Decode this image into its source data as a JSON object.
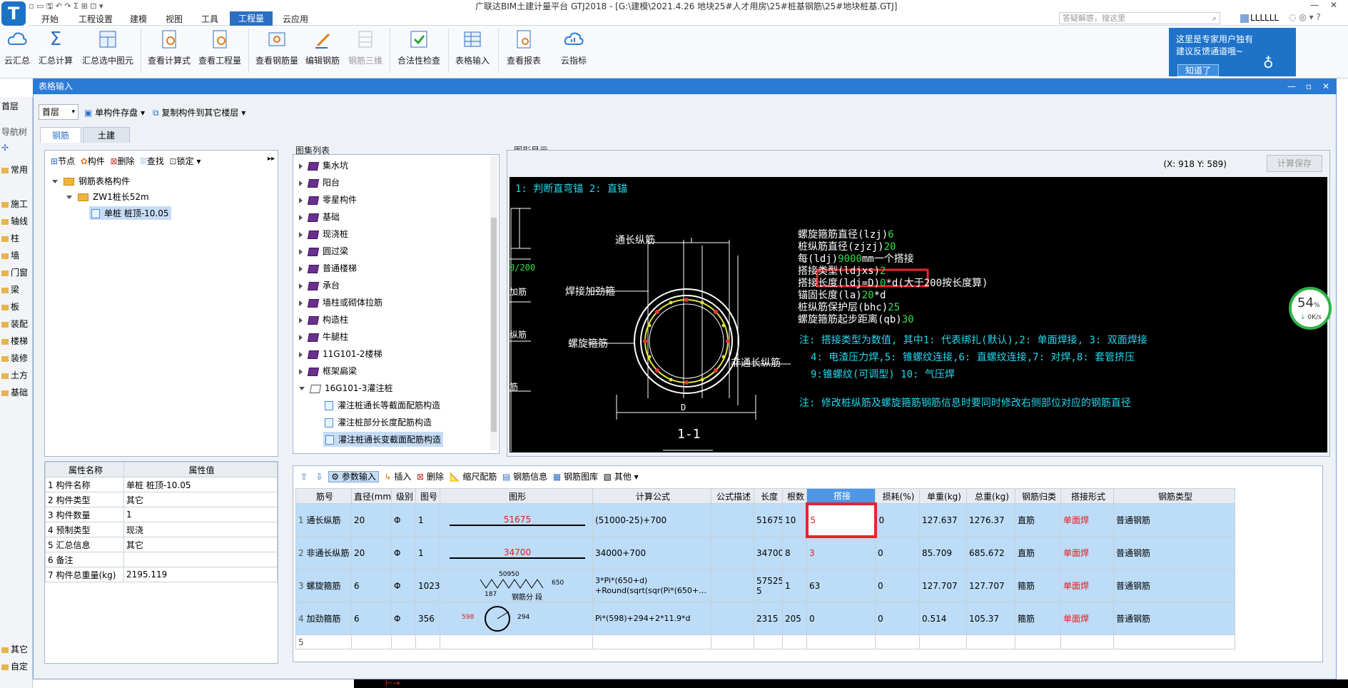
{
  "titlebar": {
    "title": "广联达BIM土建计量平台 GTJ2018 - [G:\\建模\\2021.4.26 地块25#人才用房\\25#桩基钢筋\\25#地块桩基.GTJ]",
    "search_placeholder": "答疑解惑，搜这里",
    "user": "LLLLLL"
  },
  "menu": [
    "开始",
    "工程设置",
    "建模",
    "视图",
    "工具",
    "工程量",
    "云应用"
  ],
  "ribbon": [
    "云汇总",
    "汇总计算",
    "汇总选中图元",
    "查看计算式",
    "查看工程量",
    "查看钢筋量",
    "编辑钢筋",
    "钢筋三维",
    "合法性检查",
    "表格输入",
    "查看报表",
    "云指标"
  ],
  "notice": {
    "line1": "这里是专家用户独有",
    "line2": "建议反馈通道哦~",
    "button": "知道了"
  },
  "left_strip": {
    "floor": "首层",
    "nav": "导航树",
    "items": [
      "常用",
      "施工",
      "轴线",
      "柱",
      "墙",
      "门窗",
      "梁",
      "板",
      "装配",
      "楼梯",
      "装修",
      "土方",
      "基础",
      "其它",
      "自定"
    ]
  },
  "dialog": {
    "title": "表格输入",
    "floor_select": "首层",
    "save_single": "单构件存盘",
    "copy_to_floor": "复制构件到其它楼层",
    "tabs": [
      "钢筋",
      "土建"
    ],
    "tree_toolbar": [
      "节点",
      "构件",
      "删除",
      "查找",
      "锁定"
    ],
    "tree": {
      "root": "钢筋表格构件",
      "child": "ZW1桩长52m",
      "leaf": "单桩 桩顶-10.05"
    },
    "props_headers": [
      "属性名称",
      "属性值"
    ],
    "props": [
      {
        "n": "1",
        "name": "构件名称",
        "value": "单桩 桩顶-10.05"
      },
      {
        "n": "2",
        "name": "构件类型",
        "value": "其它"
      },
      {
        "n": "3",
        "name": "构件数量",
        "value": "1"
      },
      {
        "n": "4",
        "name": "预制类型",
        "value": "现浇"
      },
      {
        "n": "5",
        "name": "汇总信息",
        "value": "其它"
      },
      {
        "n": "6",
        "name": "备注",
        "value": ""
      },
      {
        "n": "7",
        "name": "构件总重量(kg)",
        "value": "2195.119"
      }
    ],
    "atlas_title": "图集列表",
    "atlas": [
      "集水坑",
      "阳台",
      "零星构件",
      "基础",
      "现浇桩",
      "圆过梁",
      "普通楼梯",
      "承台",
      "墙柱或砌体拉筋",
      "构造柱",
      "牛腿柱",
      "11G101-2楼梯",
      "框架扁梁",
      "16G101-3灌注桩"
    ],
    "atlas_children": [
      "灌注桩通长等截面配筋构造",
      "灌注桩部分长度配筋构造",
      "灌注桩通长变截面配筋构造"
    ],
    "figure_title": "图形显示",
    "coords": "(X: 918 Y: 589)",
    "calc_save": "计算保存"
  },
  "canvas": {
    "top": "1: 判断直弯锚     2: 直锚",
    "label_long": "通长纵筋",
    "label_weld": "焊接加劲箍",
    "label_spiral": "螺旋箍筋",
    "label_nonlong": "非通长纵筋",
    "label_d": "D",
    "section": "1-1",
    "left_frag": [
      "0/200",
      "加筋",
      "纵筋",
      "筋"
    ],
    "params": [
      {
        "k": "螺旋箍筋直径(lzj)",
        "v": "6"
      },
      {
        "k": "桩纵筋直径(zjzj)",
        "v": "20"
      },
      {
        "k": "每(ldj)",
        "v": "9000",
        "s": "mm一个搭接"
      },
      {
        "k": "搭接类型(ldjxs)",
        "v": "2"
      },
      {
        "k": "搭接长度(ldj=D)",
        "v": "0",
        "s": "*d(大于200按长度算)"
      },
      {
        "k": "锚固长度(la)",
        "v": "20",
        "s": "*d"
      },
      {
        "k": "桩纵筋保护层(bhc)",
        "v": "25"
      },
      {
        "k": "螺旋箍筋起步距离(qb)",
        "v": "30"
      }
    ],
    "notes": [
      "注: 搭接类型为数值, 其中1: 代表绑扎(默认),2: 单面焊接, 3: 双面焊接",
      "4: 电渣压力焊,5: 锥螺纹连接,6: 直螺纹连接,7: 对焊,8: 套管挤压",
      "9:锥螺纹(可调型) 10: 气压焊",
      "注: 修改桩纵筋及螺旋箍筋钢筋信息时要同时修改右侧部位对应的钢筋直径"
    ]
  },
  "grid": {
    "toolbar": [
      "参数输入",
      "插入",
      "删除",
      "缩尺配筋",
      "钢筋信息",
      "钢筋图库",
      "其他"
    ],
    "headers": [
      "筋号",
      "直径(mm)",
      "级别",
      "图号",
      "图形",
      "计算公式",
      "公式描述",
      "长度",
      "根数",
      "搭接",
      "损耗(%)",
      "单重(kg)",
      "总重(kg)",
      "钢筋归类",
      "搭接形式",
      "钢筋类型"
    ],
    "rows": [
      {
        "n": "1",
        "name": "通长纵筋",
        "dia": "20",
        "grade": "Φ",
        "fig": "1",
        "shape": "51675",
        "formula": "(51000-25)+700",
        "desc": "",
        "len": "51675",
        "count": "10",
        "lap": "5",
        "loss": "0",
        "unit": "127.637",
        "total": "1276.37",
        "cat": "直筋",
        "lapform": "单面焊",
        "type": "普通钢筋"
      },
      {
        "n": "2",
        "name": "非通长纵筋",
        "dia": "20",
        "grade": "Φ",
        "fig": "1",
        "shape": "34700",
        "formula": "34000+700",
        "desc": "",
        "len": "34700",
        "count": "8",
        "lap": "3",
        "loss": "0",
        "unit": "85.709",
        "total": "685.672",
        "cat": "直筋",
        "lapform": "单面焊",
        "type": "普通钢筋"
      },
      {
        "n": "3",
        "name": "螺旋箍筋",
        "dia": "6",
        "grade": "Φ",
        "fig": "1023",
        "shape": "50950",
        "shape2": "650",
        "shape3": "187",
        "shape4": "钢筋分 段",
        "formula": "3*Pi*(650+d)",
        "formula2": "+Round(sqrt(sqr(Pi*(650+…",
        "desc": "",
        "len": "57525",
        "len2": "5",
        "count": "1",
        "lap": "63",
        "loss": "0",
        "unit": "127.707",
        "total": "127.707",
        "cat": "箍筋",
        "lapform": "单面焊",
        "type": "普通钢筋"
      },
      {
        "n": "4",
        "name": "加劲箍筋",
        "dia": "6",
        "grade": "Φ",
        "fig": "356",
        "shape": "598",
        "shape2": "294",
        "formula": "Pi*(598)+294+2*11.9*d",
        "desc": "",
        "len": "2315",
        "count": "205",
        "lap": "0",
        "loss": "0",
        "unit": "0.514",
        "total": "105.37",
        "cat": "箍筋",
        "lapform": "单面焊",
        "type": "普通钢筋"
      },
      {
        "n": "5"
      }
    ]
  },
  "meter": {
    "pct": "54",
    "unit": "%",
    "speed": "0K/s"
  },
  "colors": {
    "accent": "#2b7bd6",
    "highlight": "#e8242a",
    "canvas": "#000000",
    "cyan": "#25d7ee",
    "green": "#32e04c"
  }
}
